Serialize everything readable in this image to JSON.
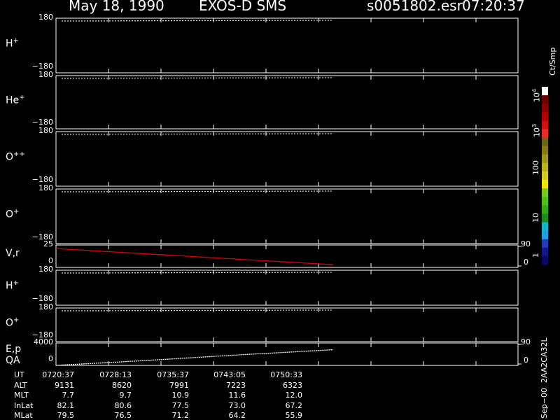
{
  "header": {
    "date": "May 18, 1990",
    "instrument": "EXOS-D SMS",
    "file": "s0051802.esr",
    "time": "07:20:37"
  },
  "panels": [
    {
      "label": "H",
      "sup": "+",
      "ymax": "180",
      "ymin": "−180"
    },
    {
      "label": "He",
      "sup": "+",
      "ymax": "180",
      "ymin": "−180"
    },
    {
      "label": "O",
      "sup": "++",
      "ymax": "180",
      "ymin": "−180"
    },
    {
      "label": "O",
      "sup": "+",
      "ymax": "180",
      "ymin": "−180"
    },
    {
      "label": "V,r",
      "sup": "",
      "ymax": "25",
      "ymin": "0",
      "right_top": "90",
      "right_bottom": "0"
    },
    {
      "label": "H",
      "sup": "+",
      "ymax": "180",
      "ymin": "−180"
    },
    {
      "label": "O",
      "sup": "+",
      "ymax": "180",
      "ymin": "−180"
    },
    {
      "label": "E,p",
      "sup": "",
      "label2": "QA",
      "ymax": "4000",
      "ymin": "0",
      "right_top": "90",
      "right_bottom": "0"
    }
  ],
  "colorbar": {
    "title": "Ct/Smp",
    "tick_labels": [
      "1",
      "10",
      "100",
      "10",
      "10"
    ],
    "tick_sups": [
      "",
      "",
      "",
      "3",
      "4"
    ],
    "colors": [
      "#ffffff",
      "#6e0000",
      "#8c0000",
      "#b00000",
      "#d21010",
      "#f02828",
      "#6e6414",
      "#877a14",
      "#a0961e",
      "#b9b41e",
      "#d2cc1e",
      "#f0e600",
      "#78c81e",
      "#50be14",
      "#32aa14",
      "#1e8c1e",
      "#14b4c8",
      "#1ea0dc",
      "#1e3cb4",
      "#14148c",
      "#0a0a64"
    ]
  },
  "table": {
    "rows": [
      {
        "name": "UT",
        "values": [
          "0720:37",
          "0728:13",
          "0735:37",
          "0743:05",
          "0750:33"
        ]
      },
      {
        "name": "ALT",
        "values": [
          "9131",
          "8620",
          "7991",
          "7223",
          "6323"
        ]
      },
      {
        "name": "MLT",
        "values": [
          "7.7",
          "9.7",
          "10.9",
          "11.6",
          "12.0"
        ]
      },
      {
        "name": "InLat",
        "values": [
          "82.1",
          "80.6",
          "77.5",
          "73.0",
          "67.2"
        ]
      },
      {
        "name": "MLat",
        "values": [
          "79.5",
          "76.5",
          "71.2",
          "64.2",
          "55.9"
        ]
      }
    ]
  },
  "footer_vertical": "Sep−00  2AA2CA32L",
  "chart_data": {
    "type": "line",
    "title": "May 18, 1990   EXOS-D SMS",
    "x_ticks": [
      "0720:37",
      "0728:13",
      "0735:37",
      "0743:05",
      "0750:33"
    ],
    "data_end_fraction": 0.6,
    "series": [
      {
        "name": "V,r",
        "color": "#e00000",
        "values": [
          21,
          15,
          9,
          3
        ]
      },
      {
        "name": "E,p",
        "color": "#ffffff",
        "values": [
          0,
          900,
          1900,
          2800
        ]
      }
    ],
    "vr_ylim": [
      0,
      25
    ],
    "ep_ylim": [
      0,
      4000
    ]
  }
}
